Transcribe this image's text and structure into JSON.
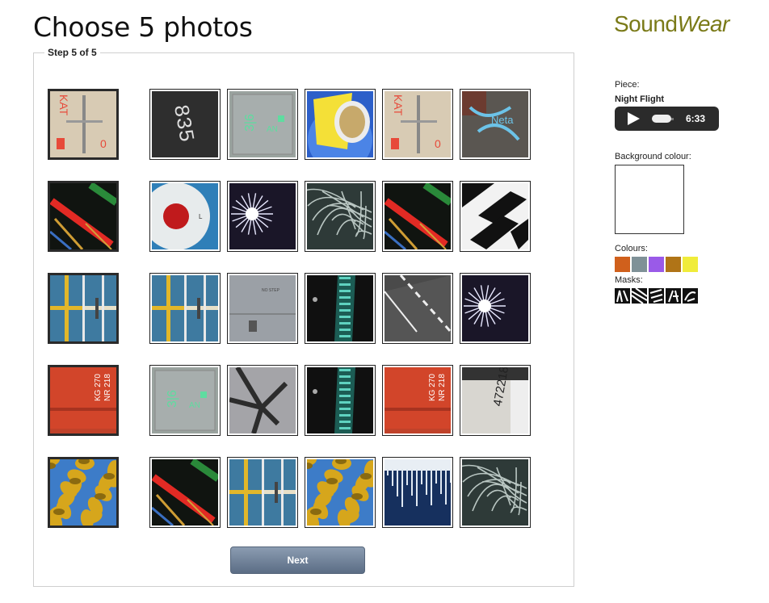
{
  "header": {
    "title": "Choose 5 photos"
  },
  "logo": {
    "part1": "Sound",
    "part2": "Wear"
  },
  "panel": {
    "step": "Step 5 of 5",
    "next_label": "Next"
  },
  "sidebar": {
    "piece_label": "Piece:",
    "piece_name": "Night Flight",
    "player_time": "6:33",
    "background_label": "Background colour:",
    "background_colour": "#ffffff",
    "colours_label": "Colours:",
    "colours": [
      "#d0601c",
      "#7f9197",
      "#9a5ae8",
      "#b07417",
      "#f0ec3a"
    ],
    "masks_label": "Masks:",
    "masks": [
      "mask-1",
      "mask-2",
      "mask-3",
      "mask-4",
      "mask-5"
    ]
  },
  "photos": [
    {
      "name": "red-sign-photo",
      "kind": "wall",
      "selected": true
    },
    {
      "name": "number-35-photo",
      "kind": "dark"
    },
    {
      "name": "grey-plate-photo",
      "kind": "plate"
    },
    {
      "name": "building-sky-photo",
      "kind": "building"
    },
    {
      "name": "red-sign-photo",
      "kind": "wall"
    },
    {
      "name": "graffiti-door-photo",
      "kind": "graffiti"
    },
    {
      "name": "red-sticks-photo",
      "kind": "sticks",
      "selected": true
    },
    {
      "name": "roundel-photo",
      "kind": "roundel"
    },
    {
      "name": "firework-photo",
      "kind": "firework"
    },
    {
      "name": "wire-tangle-photo",
      "kind": "wires"
    },
    {
      "name": "red-sticks-photo",
      "kind": "sticks"
    },
    {
      "name": "black-white-stripes-photo",
      "kind": "stripes"
    },
    {
      "name": "blue-yellow-lines-photo",
      "kind": "bluelines",
      "selected": true
    },
    {
      "name": "blue-yellow-lines-photo",
      "kind": "bluelines"
    },
    {
      "name": "grey-panel-photo",
      "kind": "panel"
    },
    {
      "name": "teal-lights-photo",
      "kind": "teal"
    },
    {
      "name": "road-markings-photo",
      "kind": "road"
    },
    {
      "name": "firework-photo",
      "kind": "firework"
    },
    {
      "name": "red-container-photo",
      "kind": "container",
      "selected": true
    },
    {
      "name": "grey-plate-photo",
      "kind": "plate"
    },
    {
      "name": "asphalt-crack-photo",
      "kind": "asphalt"
    },
    {
      "name": "teal-lights-photo",
      "kind": "teal"
    },
    {
      "name": "red-container-photo",
      "kind": "container"
    },
    {
      "name": "number-472218-photo",
      "kind": "numbers"
    },
    {
      "name": "autumn-leaves-photo",
      "kind": "leaves",
      "selected": true
    },
    {
      "name": "red-sticks-photo",
      "kind": "sticks"
    },
    {
      "name": "blue-yellow-lines-photo",
      "kind": "bluelines"
    },
    {
      "name": "autumn-leaves-photo",
      "kind": "leaves"
    },
    {
      "name": "blue-drips-photo",
      "kind": "drips"
    },
    {
      "name": "wire-tangle-photo",
      "kind": "wires"
    }
  ]
}
